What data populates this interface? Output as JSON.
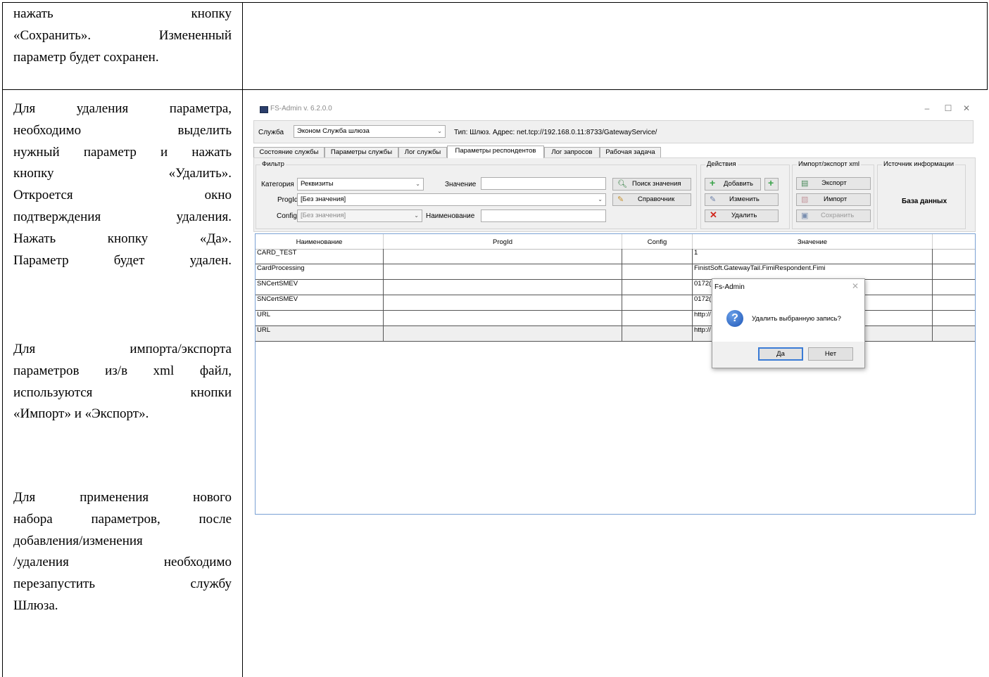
{
  "doc": {
    "top_text": [
      "нажать кнопку",
      "«Сохранить». Измененный",
      "параметр будет сохранен."
    ],
    "p1": [
      "Для удаления параметра,",
      "необходимо выделить",
      "нужный параметр и нажать",
      "кнопку «Удалить».",
      "Откроется окно",
      "подтверждения удаления.",
      "Нажать кнопку «Да».",
      "Параметр будет удален."
    ],
    "p2": [
      "Для импорта/экспорта",
      "параметров из/в xml файл,",
      "используются кнопки",
      "«Импорт» и «Экспорт»."
    ],
    "p3": [
      "Для применения нового",
      "набора параметров, после",
      "добавления/изменения",
      "/удаления необходимо",
      "перезапустить службу",
      "Шлюза."
    ]
  },
  "window": {
    "title": "FS-Admin v. 6.2.0.0",
    "minimize": "–",
    "maximize": "☐",
    "close": "✕"
  },
  "servicebar": {
    "service_label": "Служба",
    "service_value": "Эконом Служба шлюза",
    "info": "Тип: Шлюз.   Адрес: net.tcp://192.168.0.11:8733/GatewayService/"
  },
  "tabs": [
    "Состояние службы",
    "Параметры службы",
    "Лог службы",
    "Параметры респондентов",
    "Лог запросов",
    "Рабочая задача"
  ],
  "filter": {
    "title": "Фильтр",
    "category_label": "Категория",
    "category_value": "Реквизиты",
    "value_label": "Значение",
    "value_input": "",
    "progid_label": "ProgId",
    "progid_value": "[Без значения]",
    "config_label": "Config",
    "config_value": "[Без значения]",
    "name_label": "Наименование",
    "name_input": "",
    "search_button": "Поиск значения",
    "directory_button": "Справочник"
  },
  "actions": {
    "title": "Действия",
    "add": "Добавить",
    "edit": "Изменить",
    "delete": "Удалить"
  },
  "importexport": {
    "title": "Импорт/экспорт xml",
    "export": "Экспорт",
    "import": "Импорт",
    "save": "Сохранить"
  },
  "source": {
    "title": "Источник информации",
    "value": "База данных"
  },
  "grid": {
    "headers": [
      "Наименование",
      "ProgId",
      "Config",
      "Значение"
    ],
    "rows": [
      {
        "name": "CARD_TEST",
        "progid": "",
        "config": "",
        "value": "1"
      },
      {
        "name": "CardProcessing",
        "progid": "",
        "config": "",
        "value": "FinistSoft.GatewayTail.FimiRespondent.Fimi"
      },
      {
        "name": "SNCertSMEV",
        "progid": "",
        "config": "",
        "value": "0172("
      },
      {
        "name": "SNCertSMEV",
        "progid": "",
        "config": "",
        "value": "0172("
      },
      {
        "name": "URL",
        "progid": "",
        "config": "",
        "value": "http://"
      },
      {
        "name": "URL",
        "progid": "",
        "config": "",
        "value": "http://"
      }
    ]
  },
  "dialog": {
    "title": "Fs-Admin",
    "message": "Удалить выбранную запись?",
    "yes": "Да",
    "no": "Нет",
    "close": "✕"
  }
}
